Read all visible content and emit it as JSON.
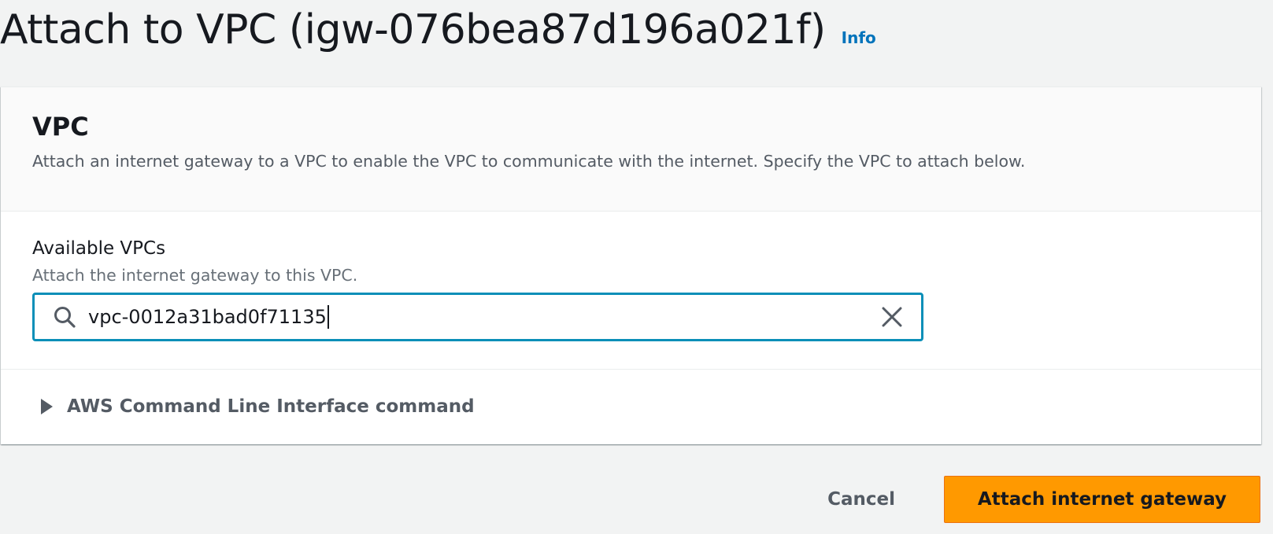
{
  "header": {
    "title": "Attach to VPC (igw-076bea87d196a021f)",
    "info_link": "Info"
  },
  "vpc_panel": {
    "title": "VPC",
    "description": "Attach an internet gateway to a VPC to enable the VPC to communicate with the internet. Specify the VPC to attach below.",
    "available_vpcs": {
      "label": "Available VPCs",
      "description": "Attach the internet gateway to this VPC.",
      "value": "vpc-0012a31bad0f71135"
    },
    "cli_expander": {
      "label": "AWS Command Line Interface command",
      "expanded": false
    }
  },
  "actions": {
    "cancel_label": "Cancel",
    "submit_label": "Attach internet gateway"
  },
  "colors": {
    "primary_button": "#ff9900",
    "focus_border": "#0a8fb8",
    "info_link": "#0073bb"
  },
  "icons": {
    "search": "search-icon",
    "clear": "close-icon",
    "caret": "caret-right-icon"
  }
}
